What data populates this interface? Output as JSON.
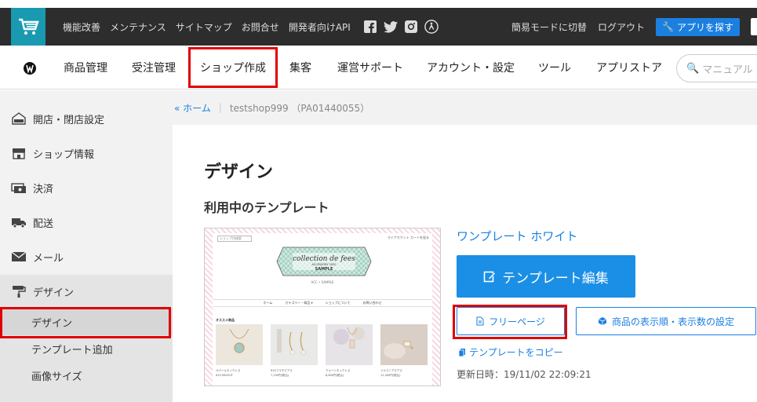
{
  "topbar": {
    "links": [
      "機能改善",
      "メンテナンス",
      "サイトマップ",
      "お問合せ",
      "開発者向けAPI"
    ],
    "simple_mode": "簡易モードに切替",
    "logout": "ログアウト",
    "app_search": "アプリを探す",
    "social_icons": [
      "facebook-icon",
      "twitter-icon",
      "instagram-icon",
      "accessibility-icon"
    ]
  },
  "mainnav": {
    "items": [
      "商品管理",
      "受注管理",
      "ショップ作成",
      "集客",
      "運営サポート",
      "アカウント・設定",
      "ツール",
      "アプリストア"
    ],
    "search_placeholder": "マニュアル"
  },
  "sidebar": {
    "items": [
      "開店・閉店設定",
      "ショップ情報",
      "決済",
      "配送",
      "メール",
      "デザイン"
    ],
    "sub_items": [
      "デザイン",
      "テンプレート追加",
      "画像サイズ"
    ]
  },
  "breadcrumb": {
    "home": "« ホーム",
    "separator": "|",
    "shop": "testshop999 （PA01440055）"
  },
  "main": {
    "title": "デザイン",
    "section_title": "利用中のテンプレート",
    "template_name": "ワンプレート ホワイト",
    "edit_button": "テンプレート編集",
    "free_page_button": "フリーページ",
    "order_button": "商品の表示順・表示数の設定",
    "copy_link": "テンプレートをコピー",
    "updated": "更新日時：19/11/02 22:09:21"
  },
  "thumbnail": {
    "search": "ショップ内検索",
    "cart": "マイアカウント カートを見る",
    "banner_script": "collection de fees",
    "banner_sub": "ACCESSORY 2020",
    "banner_sample": "SAMPLE",
    "tagline": "ACC • SAMPLE",
    "nav": [
      "ホーム",
      "カテゴリー・商品 ▾",
      "ショップについて",
      "お問い合わせ"
    ],
    "recommend": "オススメ商品",
    "products": [
      {
        "name": "オパールネックレス",
        "price": "¥15,000OUT"
      },
      {
        "name": "K10フラチピアス",
        "price": "7,150円(税込)"
      },
      {
        "name": "クォーツネックレス",
        "price": "8,800円(税込)"
      },
      {
        "name": "ジルコニアピアス",
        "price": "11,000円(税込)"
      }
    ]
  },
  "colors": {
    "accent": "#1b7fe0",
    "topbar": "#2d2d2d",
    "logo": "#1a9ab0",
    "highlight": "#e00000"
  }
}
